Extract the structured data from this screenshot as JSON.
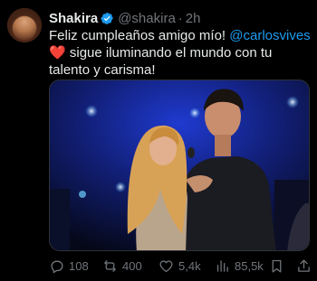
{
  "author": {
    "name": "Shakira",
    "handle": "@shakira",
    "separator": "·",
    "time": "2h"
  },
  "body": {
    "line1_prefix": "Feliz cumpleaños amigo mío! ",
    "mention": "@carlosvives",
    "heart": "❤️",
    "line2": "sigue iluminando el mundo con tu talento y carisma!"
  },
  "actions": {
    "replies": "108",
    "reposts": "400",
    "likes": "5,4k",
    "views": "85,5k"
  },
  "colors": {
    "background": "#000000",
    "text": "#e7e9ea",
    "muted": "#71767b",
    "link": "#1d9bf0",
    "verified": "#1d9bf0"
  },
  "icons": [
    "verified-badge-icon",
    "reply-icon",
    "repost-icon",
    "like-icon",
    "views-icon",
    "bookmark-icon",
    "share-icon"
  ]
}
